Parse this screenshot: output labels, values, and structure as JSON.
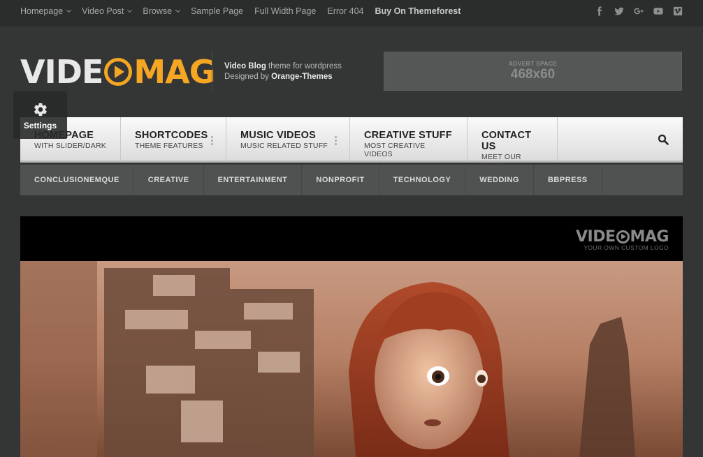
{
  "topnav": {
    "items": [
      {
        "label": "Homepage",
        "dropdown": true
      },
      {
        "label": "Video Post",
        "dropdown": true
      },
      {
        "label": "Browse",
        "dropdown": true
      },
      {
        "label": "Sample Page",
        "dropdown": false
      },
      {
        "label": "Full Width Page",
        "dropdown": false
      },
      {
        "label": "Error 404",
        "dropdown": false
      },
      {
        "label": "Buy On Themeforest",
        "dropdown": false,
        "bold": true
      }
    ],
    "social": [
      "facebook-icon",
      "twitter-icon",
      "google-plus-icon",
      "youtube-icon",
      "vimeo-icon"
    ]
  },
  "header": {
    "logo_part1": "VIDE",
    "logo_part2": "MAG",
    "tagline_bold1": "Video Blog",
    "tagline_rest1": " theme for wordpress",
    "tagline_rest2": "Designed by ",
    "tagline_bold2": "Orange-Themes",
    "advert_small": "ADVERT SPACE",
    "advert_big": "468x60"
  },
  "mainnav": {
    "items": [
      {
        "title": "HOMEPAGE",
        "subtitle": "WITH SLIDER/DARK",
        "has_sub": false
      },
      {
        "title": "SHORTCODES",
        "subtitle": "THEME FEATURES",
        "has_sub": true
      },
      {
        "title": "MUSIC VIDEOS",
        "subtitle": "MUSIC RELATED STUFF",
        "has_sub": true
      },
      {
        "title": "CREATIVE STUFF",
        "subtitle": "MOST CREATIVE VIDEOS",
        "has_sub": false
      },
      {
        "title": "CONTACT US",
        "subtitle": "MEET OUR TEAM",
        "has_sub": false
      }
    ]
  },
  "catnav": {
    "items": [
      "CONCLUSIONEMQUE",
      "CREATIVE",
      "ENTERTAINMENT",
      "NONPROFIT",
      "TECHNOLOGY",
      "WEDDING",
      "BBPRESS"
    ]
  },
  "settings": {
    "label": "Settings"
  },
  "video": {
    "logo_part1": "VIDE",
    "logo_part2": "MAG",
    "logo_sub": "YOUR OWN CUSTOM LOGO"
  },
  "colors": {
    "accent": "#f5a623",
    "background": "#343535"
  }
}
